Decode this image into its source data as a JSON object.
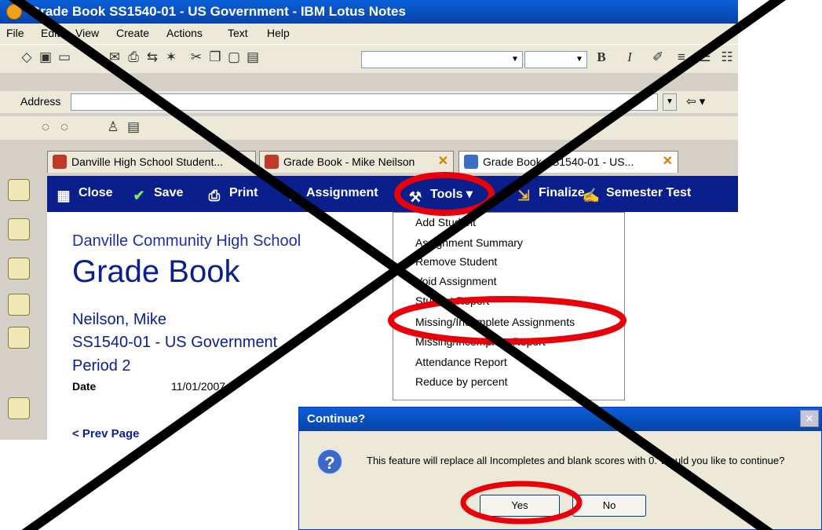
{
  "window": {
    "title": "Grade Book SS1540-01 - US Government - IBM Lotus Notes"
  },
  "menu": [
    "File",
    "Edit",
    "View",
    "Create",
    "Actions",
    "Text",
    "Help"
  ],
  "addressbar": {
    "label": "Address",
    "value": ""
  },
  "tabs": [
    {
      "label": "Danville High School Student..."
    },
    {
      "label": "Grade Book - Mike Neilson"
    },
    {
      "label": "Grade Book SS1540-01 - US..."
    }
  ],
  "actions": [
    "Close",
    "Save",
    "Print",
    "Assignment",
    "Tools",
    "Finalize",
    "Semester Test"
  ],
  "document": {
    "school": "Danville Community High School",
    "heading": "Grade Book",
    "student": "Neilson, Mike",
    "course": "SS1540-01 - US Government",
    "period": "Period 2",
    "date_label": "Date",
    "date_value": "11/01/2007",
    "prev_page": "< Prev Page"
  },
  "tools_menu": [
    "Add Student",
    "Assignment Summary",
    "Remove Student",
    "Void Assignment",
    "Student Report",
    "Missing/Incomplete Assignments",
    "Missing/Incomplete Report",
    "Attendance Report",
    "Reduce by percent"
  ],
  "dialog": {
    "title": "Continue?",
    "message": "This feature will replace all Incompletes and blank scores with 0.  Would you like to continue?",
    "yes": "Yes",
    "no": "No"
  },
  "colors": {
    "annotation_red": "#e8000b",
    "action_bar": "#0a1f8c",
    "title_blue": "#0a2091"
  }
}
